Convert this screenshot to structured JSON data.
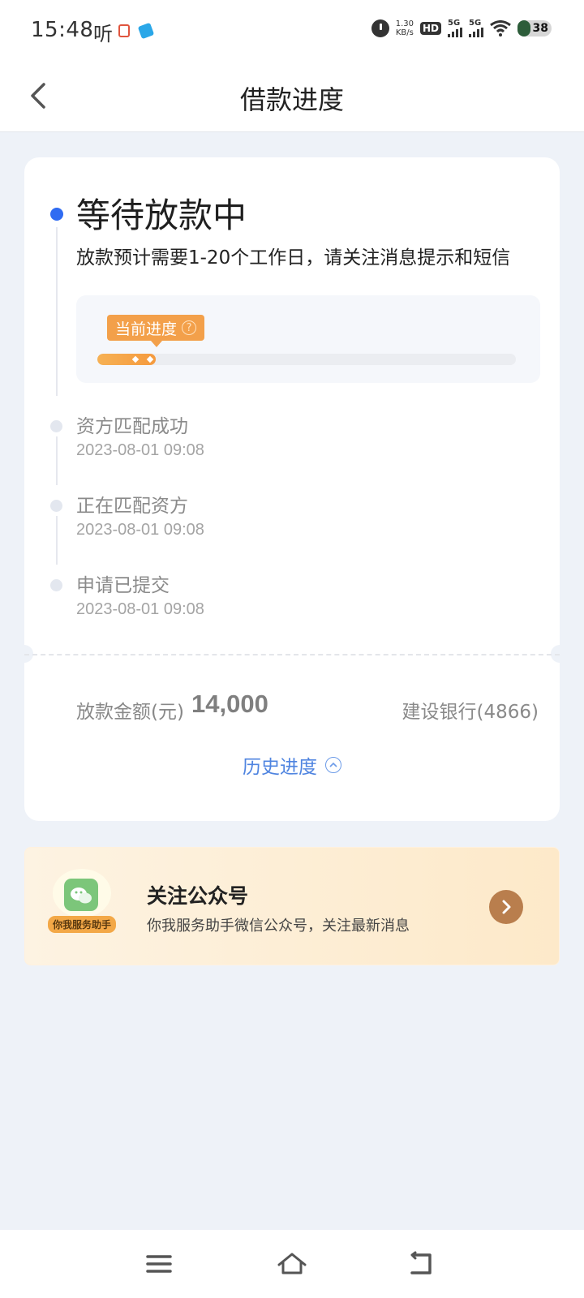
{
  "status_bar": {
    "time": "15:48",
    "ting": "听",
    "speed_top": "1.30",
    "speed_unit": "KB/s",
    "hd": "HD",
    "signal_label": "5G",
    "battery": "38"
  },
  "header": {
    "title": "借款进度"
  },
  "progress": {
    "status_title": "等待放款中",
    "status_desc": "放款预计需要1-20个工作日，请关注消息提示和短信",
    "tag_label": "当前进度",
    "fill_fraction": 0.14
  },
  "steps": [
    {
      "label": "资方匹配成功",
      "time": "2023-08-01 09:08"
    },
    {
      "label": "正在匹配资方",
      "time": "2023-08-01 09:08"
    },
    {
      "label": "申请已提交",
      "time": "2023-08-01 09:08"
    }
  ],
  "loan": {
    "amount_label": "放款金额(元)",
    "amount_value": "14,000",
    "bank": "建设银行(4866)",
    "history_link": "历史进度"
  },
  "follow": {
    "badge": "你我服务助手",
    "title": "关注公众号",
    "subtitle": "你我服务助手微信公众号，关注最新消息"
  },
  "colors": {
    "accent_blue": "#2f6bf2",
    "progress_orange": "#f3a04a",
    "link_blue": "#4f84e0",
    "page_bg": "#eef2f8"
  }
}
